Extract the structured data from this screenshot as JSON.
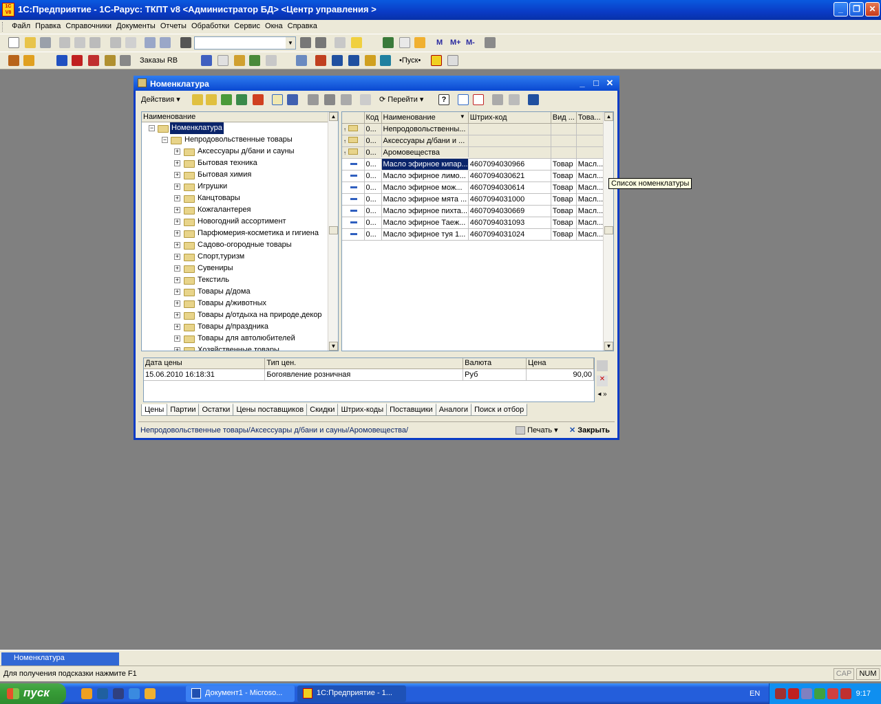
{
  "app": {
    "title": "1С:Предприятие - 1С-Рарус: ТКПТ v8 <Администратор БД> <Центр управления >",
    "logo_text": "1С V8"
  },
  "menu": [
    "Файл",
    "Правка",
    "Справочники",
    "Документы",
    "Отчеты",
    "Обработки",
    "Сервис",
    "Окна",
    "Справка"
  ],
  "toolbar": {
    "orders_label": "Заказы RB",
    "start_label": "•Пуск•",
    "m_labels": [
      "М",
      "М+",
      "М-"
    ],
    "search_value": ""
  },
  "window": {
    "title": "Номенклатура",
    "actions_label": "Действия",
    "goto_label": "Перейти",
    "help_label": "?",
    "tooltip": "Список номенклатуры",
    "tree": {
      "header": "Наименование",
      "root": "Номенклатура",
      "group": "Непродовольственные товары",
      "items": [
        "Аксессуары д/бани и сауны",
        "Бытовая техника",
        "Бытовая химия",
        "Игрушки",
        "Канцтовары",
        "Кожгалантерея",
        "Новогодний ассортимент",
        "Парфюмерия-косметика и гигиена",
        "Садово-огородные товары",
        "Спорт,туризм",
        "Сувениры",
        "Текстиль",
        "Товары д/дома",
        "Товары д/животных",
        "Товары д/отдыха на природе,декор",
        "Товары д/праздника",
        "Товары для автолюбителей",
        "Хозяйственные товары"
      ]
    },
    "grid": {
      "columns": [
        "Код",
        "Наименование",
        "Штрих-код",
        "Вид ...",
        "Това..."
      ],
      "groups": [
        {
          "code": "0...",
          "name": "Непродовольственны..."
        },
        {
          "code": "0...",
          "name": "Аксессуары д/бани и ..."
        },
        {
          "code": "0...",
          "name": "Аромовещества"
        }
      ],
      "rows": [
        {
          "code": "0...",
          "name": "Масло эфирное кипар...",
          "barcode": "4607094030966",
          "kind": "Товар",
          "type": "Масл..."
        },
        {
          "code": "0...",
          "name": "Масло эфирное лимо...",
          "barcode": "4607094030621",
          "kind": "Товар",
          "type": "Масл..."
        },
        {
          "code": "0...",
          "name": "Масло эфирное мож...",
          "barcode": "4607094030614",
          "kind": "Товар",
          "type": "Масл..."
        },
        {
          "code": "0...",
          "name": "Масло эфирное мята ...",
          "barcode": "4607094031000",
          "kind": "Товар",
          "type": "Масл..."
        },
        {
          "code": "0...",
          "name": "Масло эфирное пихта...",
          "barcode": "4607094030669",
          "kind": "Товар",
          "type": "Масл..."
        },
        {
          "code": "0...",
          "name": "Масло эфирное Таеж...",
          "barcode": "4607094031093",
          "kind": "Товар",
          "type": "Масл..."
        },
        {
          "code": "0...",
          "name": "Масло эфирное туя 1...",
          "barcode": "4607094031024",
          "kind": "Товар",
          "type": "Масл..."
        }
      ]
    },
    "prices": {
      "columns": [
        "Дата цены",
        "Тип цен.",
        "Валюта",
        "Цена"
      ],
      "rows": [
        {
          "date": "15.06.2010 16:18:31",
          "type": "Богоявление розничная",
          "currency": "Руб",
          "price": "90,00"
        }
      ]
    },
    "tabs": [
      "Цены",
      "Партии",
      "Остатки",
      "Цены поставщиков",
      "Скидки",
      "Штрих-коды",
      "Поставщики",
      "Аналоги",
      "Поиск и отбор"
    ],
    "active_tab": "Цены",
    "path": "Непродовольственные товары/Аксессуары д/бани и сауны/Аромовещества/",
    "print_label": "Печать",
    "close_label": "Закрыть"
  },
  "windows_bar": {
    "item": "Номенклатура"
  },
  "statusbar": {
    "hint": "Для получения подсказки нажмите F1",
    "cap": "CAP",
    "num": "NUM"
  },
  "taskbar": {
    "start": "пуск",
    "tasks": [
      "Документ1 - Microso...",
      "1С:Предприятие - 1..."
    ],
    "lang": "EN",
    "time": "9:17"
  }
}
